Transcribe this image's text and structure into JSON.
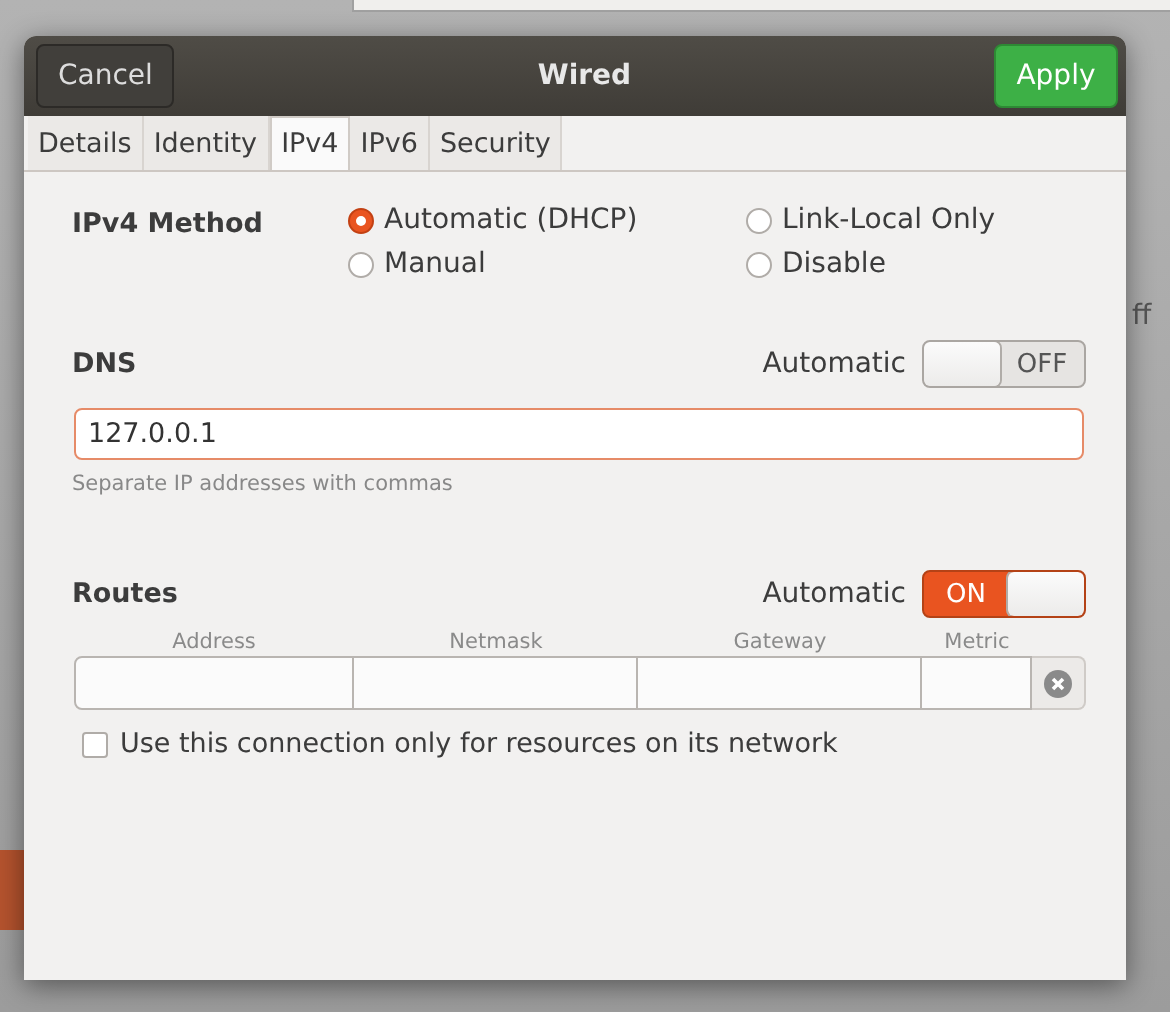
{
  "background": {
    "label": "ff"
  },
  "dialog": {
    "title": "Wired",
    "cancel": "Cancel",
    "apply": "Apply"
  },
  "tabs": [
    {
      "label": "Details",
      "selected": false
    },
    {
      "label": "Identity",
      "selected": false
    },
    {
      "label": "IPv4",
      "selected": true
    },
    {
      "label": "IPv6",
      "selected": false
    },
    {
      "label": "Security",
      "selected": false
    }
  ],
  "ipv4_method": {
    "label": "IPv4 Method",
    "options": [
      {
        "label": "Automatic (DHCP)",
        "selected": true
      },
      {
        "label": "Link-Local Only",
        "selected": false
      },
      {
        "label": "Manual",
        "selected": false
      },
      {
        "label": "Disable",
        "selected": false
      }
    ]
  },
  "dns": {
    "label": "DNS",
    "automatic_label": "Automatic",
    "toggle": {
      "on": false,
      "text": "OFF"
    },
    "value": "127.0.0.1",
    "hint": "Separate IP addresses with commas"
  },
  "routes": {
    "label": "Routes",
    "automatic_label": "Automatic",
    "toggle": {
      "on": true,
      "text": "ON"
    },
    "columns": [
      "Address",
      "Netmask",
      "Gateway",
      "Metric"
    ]
  },
  "only_local": {
    "label": "Use this connection only for resources on its network",
    "checked": false
  }
}
